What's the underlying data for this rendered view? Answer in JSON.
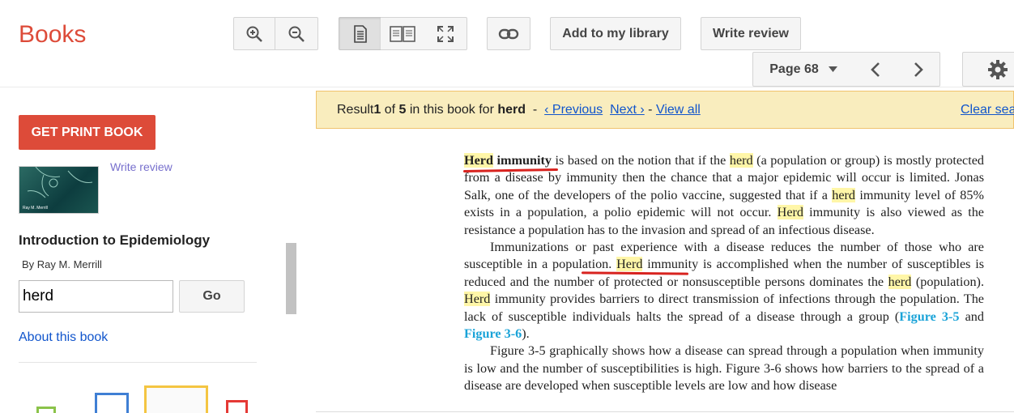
{
  "app": {
    "logo": "Books"
  },
  "toolbar": {
    "add_to_library": "Add to my library",
    "write_review": "Write review",
    "page_label": "Page 68"
  },
  "sidebar": {
    "print_button": "GET PRINT BOOK",
    "cover_text": "Ray M. Merrill",
    "write_review_link": "Write review",
    "book_title": "Introduction to Epidemiology",
    "book_author": "By Ray M. Merrill",
    "search_value": "herd",
    "go_button": "Go",
    "about_link": "About this book"
  },
  "result_bar": {
    "prefix": "Result ",
    "current": "1",
    "of": " of ",
    "total": "5",
    "mid": " in this book for ",
    "query": "herd",
    "sep1": "  -  ",
    "previous": "‹ Previous",
    "next": "Next ›",
    "sep2": " - ",
    "view_all": "View all",
    "clear": "Clear search"
  },
  "page": {
    "p1": [
      {
        "t": "Herd",
        "hl": true,
        "b": true
      },
      {
        "t": " ",
        "b": true
      },
      {
        "t": "immunity",
        "b": true
      },
      {
        "t": " is based on the notion that if the "
      },
      {
        "t": "herd",
        "hl": true
      },
      {
        "t": " (a population or group) is mostly protected from a disease by immunity then the chance that a major epidemic will occur is limited. Jonas Salk, one of the developers of the polio vaccine, suggested that if a "
      },
      {
        "t": "herd",
        "hl": true
      },
      {
        "t": " immunity level of 85% exists in a population, a polio epidemic will not occur. "
      },
      {
        "t": "Herd",
        "hl": true
      },
      {
        "t": " immu­nity is also viewed as the resistance a population has to the invasion and spread of an infectious disease."
      }
    ],
    "p2": [
      {
        "t": "Immunizations or past experience with a disease reduces the number of those who are susceptible in a population. "
      },
      {
        "t": "Herd",
        "hl": true
      },
      {
        "t": " immunity is accomplished when the number of suscep­tibles is reduced and the number of protected or nonsusceptible persons dominates the "
      },
      {
        "t": "herd",
        "hl": true
      },
      {
        "t": " (population). "
      },
      {
        "t": "Herd",
        "hl": true
      },
      {
        "t": " immunity provides barriers to direct transmission of infections through the population. The lack of susceptible individuals halts the spread of a disease through a group ("
      },
      {
        "t": "Figure 3-5",
        "fig": true
      },
      {
        "t": " and "
      },
      {
        "t": "Figure 3-6",
        "fig": true
      },
      {
        "t": ")."
      }
    ],
    "p3": [
      {
        "t": "Figure 3-5 graphically shows how a disease can spread through a population when immunity is low and the number of susceptibilities is high. Figure 3-6 shows how barriers to the spread of a disease are developed when susceptible levels are low and how disease"
      }
    ]
  },
  "colors": {
    "brand": "#dd4b39",
    "link": "#1155cc",
    "highlight": "#fff6a8",
    "result_bar_bg": "#f9edbe",
    "figure_link": "#1aa3d8",
    "annotation": "#d8231f"
  },
  "icons": [
    "zoom-in-icon",
    "zoom-out-icon",
    "single-page-icon",
    "two-page-icon",
    "fullscreen-icon",
    "link-icon",
    "caret-down-icon",
    "chevron-left-icon",
    "chevron-right-icon",
    "gear-icon"
  ]
}
